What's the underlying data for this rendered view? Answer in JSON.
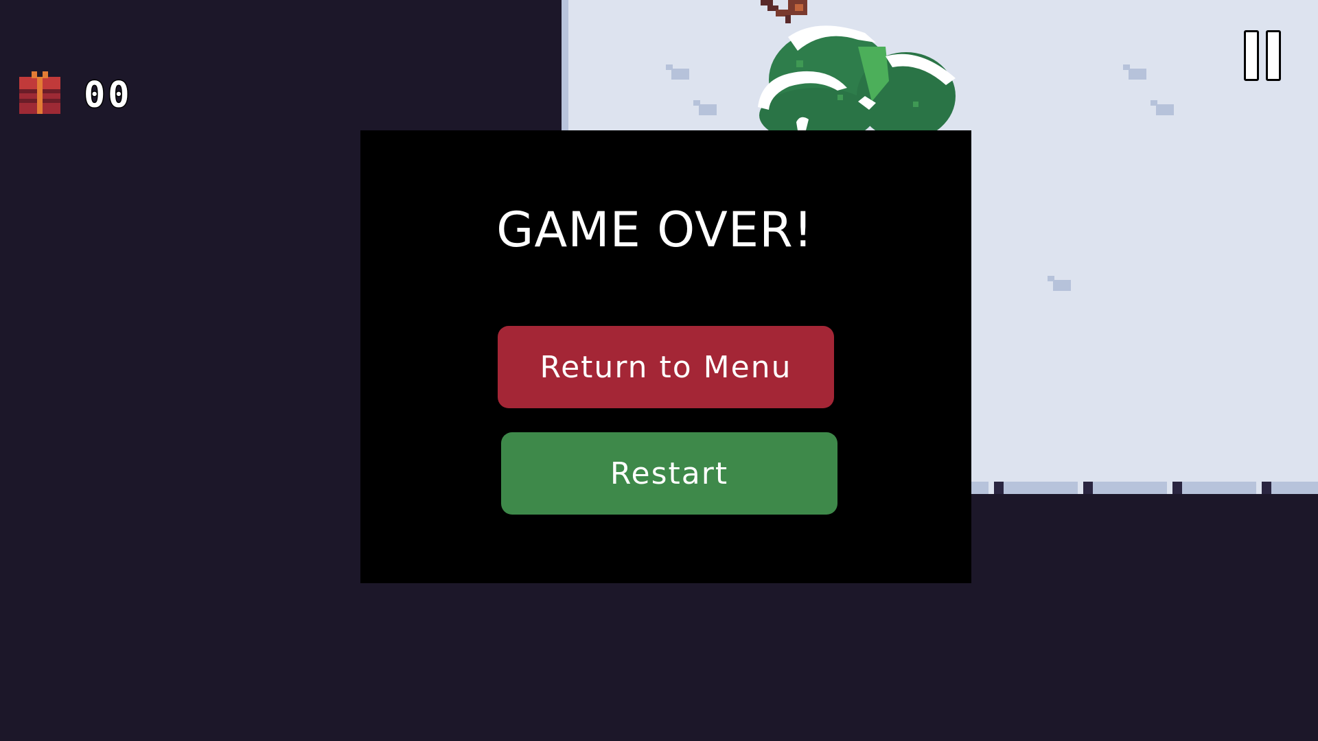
{
  "hud": {
    "gift_count": "00",
    "gift_icon": "gift-icon",
    "pause_icon": "pause-icon"
  },
  "dialog": {
    "title": "GAME OVER!",
    "return_label": "Return to Menu",
    "restart_label": "Restart"
  },
  "colors": {
    "background": "#1c1729",
    "snow": "#dde3ef",
    "return_button": "#a42636",
    "restart_button": "#3e894a",
    "panel": "#000000"
  }
}
